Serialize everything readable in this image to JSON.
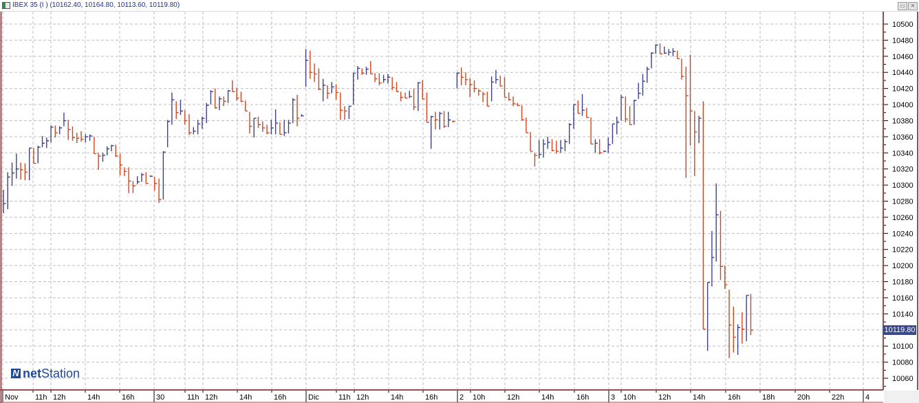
{
  "window": {
    "title": "IBEX 35 (I ) (10162.40, 10164.80, 10113.60, 10119.80)",
    "restore_icon": "restore-icon",
    "close_icon": "close-icon"
  },
  "logo": {
    "brand_a": "net",
    "brand_b": "Station",
    "mark": "N"
  },
  "colors": {
    "up": "#3b3f8c",
    "down": "#d0461c",
    "grid": "#bdbdbd",
    "frame": "#9c4c4c",
    "last_bg": "#3a478a"
  },
  "chart_data": {
    "type": "ohlc",
    "instrument": "IBEX 35 (I )",
    "last": {
      "open": 10162.4,
      "high": 10164.8,
      "low": 10113.6,
      "close": 10119.8
    },
    "last_label": "10119.80",
    "ylim": [
      10045,
      10515
    ],
    "y_ticks": [
      "10500",
      "10480",
      "10460",
      "10440",
      "10420",
      "10400",
      "10380",
      "10360",
      "10340",
      "10320",
      "10300",
      "10280",
      "10260",
      "10240",
      "10220",
      "10200",
      "10180",
      "10160",
      "10140",
      "10120",
      "10100",
      "10080",
      "10060"
    ],
    "x_ticks": [
      "Nov",
      "11h",
      "12h",
      "14h",
      "16h",
      "30",
      "11h",
      "12h",
      "14h",
      "16h",
      "Dic",
      "11h",
      "12h",
      "14h",
      "16h",
      "2",
      "10h",
      "12h",
      "14h",
      "16h",
      "3",
      "10h",
      "12h",
      "14h",
      "16h",
      "18h",
      "20h",
      "22h",
      "4"
    ],
    "grid": true,
    "bars_hlc": [
      [
        10294,
        10265,
        10277
      ],
      [
        10316,
        10270,
        10310
      ],
      [
        10328,
        10299,
        10315
      ],
      [
        10339,
        10308,
        10320
      ],
      [
        10328,
        10307,
        10319
      ],
      [
        10327,
        10306,
        10316
      ],
      [
        10346,
        10306,
        10346
      ],
      [
        10346,
        10327,
        10327
      ],
      [
        10349,
        10327,
        10347
      ],
      [
        10361,
        10347,
        10352
      ],
      [
        10359,
        10346,
        10355
      ],
      [
        10374,
        10353,
        10372
      ],
      [
        10374,
        10359,
        10365
      ],
      [
        10373,
        10363,
        10371
      ],
      [
        10390,
        10373,
        10380
      ],
      [
        10381,
        10356,
        10369
      ],
      [
        10373,
        10355,
        10359
      ],
      [
        10365,
        10352,
        10358
      ],
      [
        10367,
        10354,
        10357
      ],
      [
        10363,
        10353,
        10360
      ],
      [
        10363,
        10355,
        10361
      ],
      [
        10360,
        10339,
        10339
      ],
      [
        10340,
        10319,
        10336
      ],
      [
        10340,
        10329,
        10337
      ],
      [
        10348,
        10337,
        10345
      ],
      [
        10350,
        10342,
        10349
      ],
      [
        10350,
        10335,
        10336
      ],
      [
        10339,
        10312,
        10325
      ],
      [
        10322,
        10311,
        10317
      ],
      [
        10322,
        10290,
        10305
      ],
      [
        10305,
        10290,
        10299
      ],
      [
        10311,
        10301,
        10304
      ],
      [
        10315,
        10304,
        10313
      ],
      [
        10316,
        10302,
        10302
      ],
      [
        10312,
        10310,
        10311
      ],
      [
        10310,
        10293,
        10302
      ],
      [
        10308,
        10278,
        10282
      ],
      [
        10342,
        10282,
        10341
      ],
      [
        10381,
        10347,
        10379
      ],
      [
        10415,
        10375,
        10406
      ],
      [
        10404,
        10382,
        10390
      ],
      [
        10406,
        10387,
        10392
      ],
      [
        10393,
        10375,
        10380
      ],
      [
        10388,
        10362,
        10365
      ],
      [
        10372,
        10363,
        10367
      ],
      [
        10381,
        10363,
        10376
      ],
      [
        10385,
        10370,
        10383
      ],
      [
        10402,
        10377,
        10399
      ],
      [
        10418,
        10400,
        10416
      ],
      [
        10420,
        10395,
        10396
      ],
      [
        10410,
        10393,
        10407
      ],
      [
        10410,
        10398,
        10404
      ],
      [
        10418,
        10402,
        10417
      ],
      [
        10430,
        10416,
        10416
      ],
      [
        10421,
        10405,
        10408
      ],
      [
        10416,
        10403,
        10404
      ],
      [
        10405,
        10392,
        10392
      ],
      [
        10391,
        10364,
        10373
      ],
      [
        10383,
        10359,
        10383
      ],
      [
        10385,
        10371,
        10375
      ],
      [
        10379,
        10366,
        10371
      ],
      [
        10375,
        10363,
        10365
      ],
      [
        10381,
        10363,
        10371
      ],
      [
        10394,
        10363,
        10377
      ],
      [
        10378,
        10363,
        10363
      ],
      [
        10381,
        10361,
        10365
      ],
      [
        10381,
        10364,
        10377
      ],
      [
        10408,
        10377,
        10406
      ],
      [
        10412,
        10373,
        10383
      ],
      [
        10388,
        10385,
        10386
      ],
      [
        10469,
        10422,
        10455
      ],
      [
        10467,
        10432,
        10440
      ],
      [
        10451,
        10428,
        10438
      ],
      [
        10445,
        10418,
        10419
      ],
      [
        10432,
        10404,
        10424
      ],
      [
        10424,
        10407,
        10414
      ],
      [
        10428,
        10414,
        10422
      ],
      [
        10425,
        10406,
        10415
      ],
      [
        10415,
        10381,
        10393
      ],
      [
        10398,
        10381,
        10392
      ],
      [
        10398,
        10382,
        10398
      ],
      [
        10439,
        10400,
        10439
      ],
      [
        10448,
        10431,
        10445
      ],
      [
        10445,
        10437,
        10439
      ],
      [
        10447,
        10437,
        10444
      ],
      [
        10454,
        10438,
        10438
      ],
      [
        10439,
        10428,
        10432
      ],
      [
        10439,
        10424,
        10427
      ],
      [
        10437,
        10427,
        10431
      ],
      [
        10438,
        10426,
        10434
      ],
      [
        10434,
        10418,
        10421
      ],
      [
        10428,
        10416,
        10416
      ],
      [
        10416,
        10404,
        10409
      ],
      [
        10415,
        10408,
        10408
      ],
      [
        10417,
        10408,
        10410
      ],
      [
        10420,
        10393,
        10397
      ],
      [
        10428,
        10392,
        10427
      ],
      [
        10430,
        10407,
        10407
      ],
      [
        10415,
        10378,
        10378
      ],
      [
        10386,
        10345,
        10385
      ],
      [
        10391,
        10369,
        10381
      ],
      [
        10391,
        10369,
        10389
      ],
      [
        10392,
        10371,
        10373
      ],
      [
        10391,
        10372,
        10381
      ],
      [
        10380,
        10378,
        10379
      ],
      [
        10440,
        10420,
        10439
      ],
      [
        10446,
        10424,
        10434
      ],
      [
        10440,
        10424,
        10431
      ],
      [
        10433,
        10409,
        10425
      ],
      [
        10430,
        10415,
        10420
      ],
      [
        10419,
        10411,
        10417
      ],
      [
        10416,
        10403,
        10413
      ],
      [
        10416,
        10398,
        10398
      ],
      [
        10435,
        10404,
        10428
      ],
      [
        10443,
        10426,
        10431
      ],
      [
        10436,
        10423,
        10423
      ],
      [
        10434,
        10409,
        10409
      ],
      [
        10415,
        10405,
        10406
      ],
      [
        10410,
        10398,
        10401
      ],
      [
        10402,
        10398,
        10399
      ],
      [
        10399,
        10381,
        10381
      ],
      [
        10384,
        10365,
        10365
      ],
      [
        10366,
        10342,
        10342
      ],
      [
        10340,
        10323,
        10337
      ],
      [
        10356,
        10333,
        10338
      ],
      [
        10357,
        10334,
        10351
      ],
      [
        10360,
        10345,
        10353
      ],
      [
        10357,
        10342,
        10343
      ],
      [
        10355,
        10339,
        10342
      ],
      [
        10356,
        10340,
        10346
      ],
      [
        10357,
        10342,
        10354
      ],
      [
        10377,
        10351,
        10375
      ],
      [
        10400,
        10370,
        10400
      ],
      [
        10405,
        10389,
        10389
      ],
      [
        10413,
        10386,
        10393
      ],
      [
        10396,
        10384,
        10384
      ],
      [
        10384,
        10351,
        10351
      ],
      [
        10357,
        10340,
        10352
      ],
      [
        10357,
        10338,
        10340
      ],
      [
        10343,
        10341,
        10342
      ],
      [
        10359,
        10340,
        10350
      ],
      [
        10376,
        10351,
        10376
      ],
      [
        10385,
        10363,
        10378
      ],
      [
        10412,
        10380,
        10409
      ],
      [
        10410,
        10378,
        10382
      ],
      [
        10398,
        10375,
        10375
      ],
      [
        10406,
        10375,
        10405
      ],
      [
        10427,
        10407,
        10414
      ],
      [
        10438,
        10411,
        10429
      ],
      [
        10447,
        10427,
        10444
      ],
      [
        10465,
        10445,
        10464
      ],
      [
        10475,
        10463,
        10474
      ],
      [
        10476,
        10463,
        10463
      ],
      [
        10472,
        10463,
        10464
      ],
      [
        10469,
        10461,
        10465
      ],
      [
        10470,
        10460,
        10466
      ],
      [
        10467,
        10457,
        10457
      ],
      [
        10457,
        10431,
        10435
      ],
      [
        10447,
        10309,
        10411
      ],
      [
        10462,
        10349,
        10392
      ],
      [
        10392,
        10311,
        10366
      ],
      [
        10386,
        10352,
        10383
      ],
      [
        10404,
        10121,
        10121
      ],
      [
        10179,
        10094,
        10179
      ],
      [
        10243,
        10174,
        10210
      ],
      [
        10302,
        10205,
        10263
      ],
      [
        10268,
        10182,
        10199
      ],
      [
        10200,
        10171,
        10176
      ],
      [
        10170,
        10085,
        10126
      ],
      [
        10149,
        10092,
        10111
      ],
      [
        10127,
        10089,
        10123
      ],
      [
        10142,
        10103,
        10121
      ],
      [
        10163,
        10106,
        10163
      ],
      [
        10164.8,
        10113.6,
        10119.8
      ]
    ]
  }
}
